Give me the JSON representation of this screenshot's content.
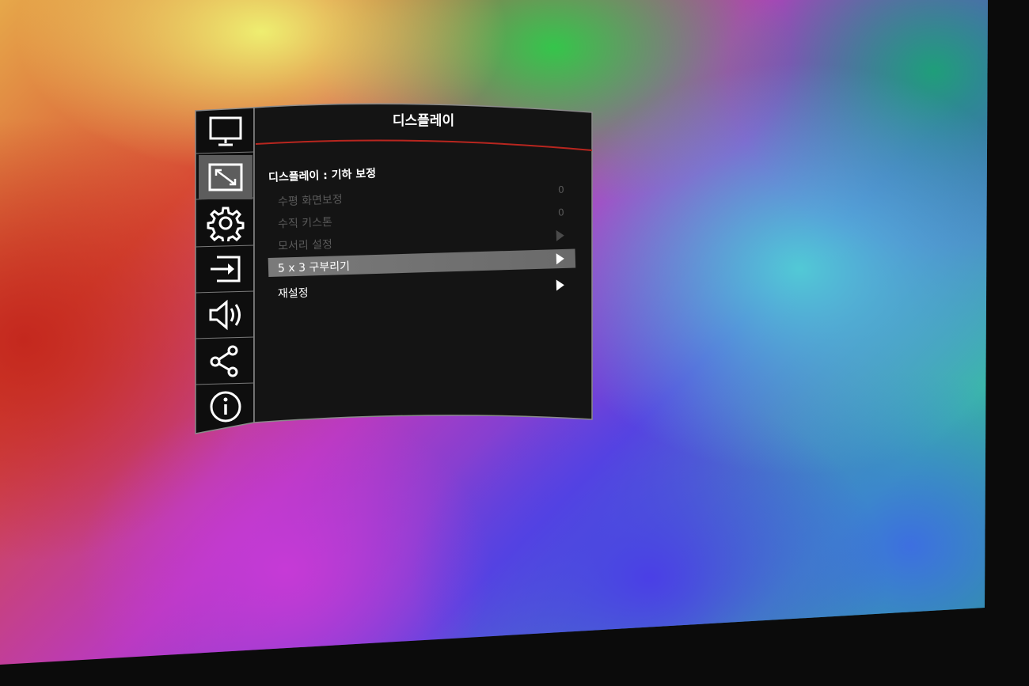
{
  "osd": {
    "title": "디스플레이",
    "section_title": "디스플레이 : 기하 보정",
    "sidebar_icons": [
      "monitor-icon",
      "geometric-correction-icon",
      "gear-icon",
      "input-icon",
      "speaker-icon",
      "share-network-icon",
      "info-icon"
    ],
    "active_sidebar_index": 1,
    "items": [
      {
        "label": "수평 화면보정",
        "value": "0",
        "enabled": false
      },
      {
        "label": "수직 키스톤",
        "value": "0",
        "enabled": false
      },
      {
        "label": "모서리 설정",
        "enabled": false
      },
      {
        "label": "5 x 3 구부리기",
        "enabled": true,
        "selected": true
      },
      {
        "label": "재설정",
        "enabled": true
      }
    ]
  },
  "colors": {
    "panel_background": "#141414",
    "panel_border": "#8a8a8a",
    "title_underline": "#b8261f",
    "selected_row": "#707070",
    "disabled_text": "#5a5a5a"
  }
}
